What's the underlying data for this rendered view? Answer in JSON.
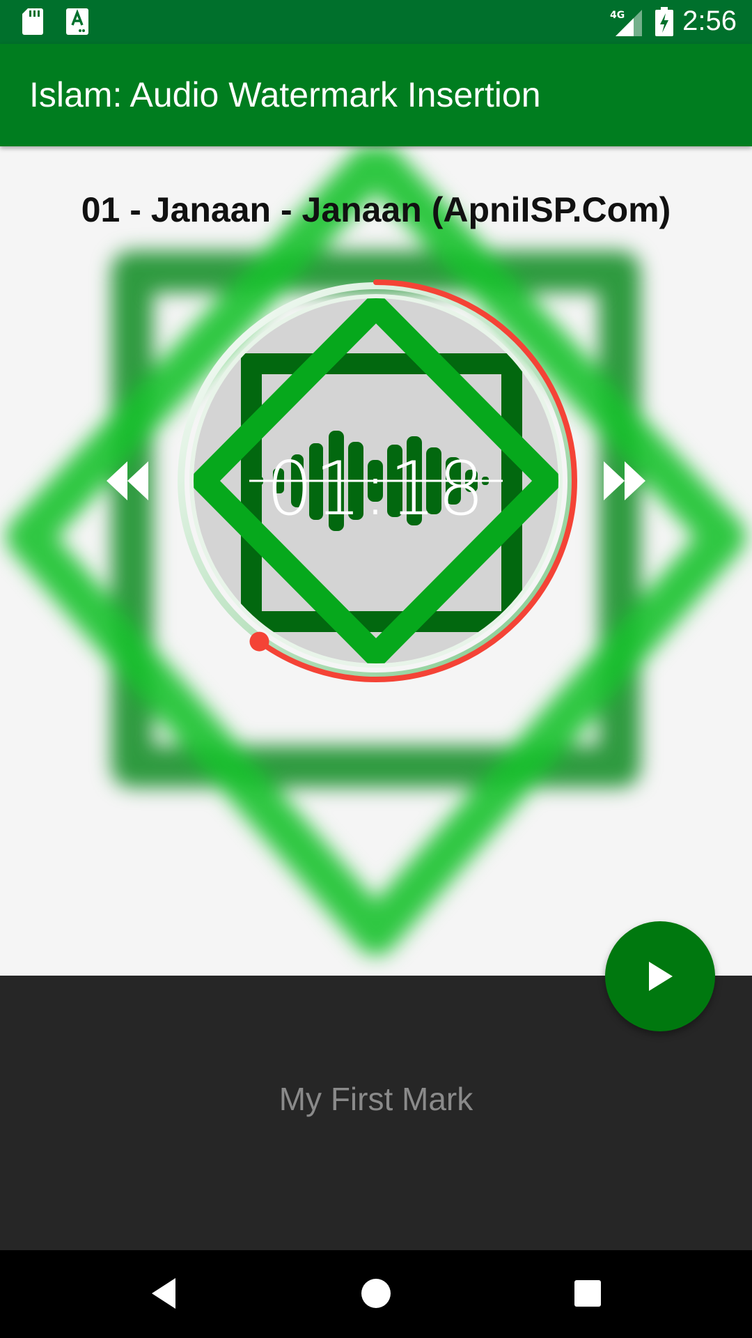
{
  "status_bar": {
    "network": "4G",
    "time": "2:56",
    "icons": [
      "sd-card-icon",
      "keyboard-a-icon",
      "signal-4g-icon",
      "battery-charging-icon"
    ]
  },
  "app_bar": {
    "title": "Islam: Audio Watermark Insertion"
  },
  "player": {
    "song_title": "01 - Janaan - Janaan (ApniISP.Com)",
    "elapsed": "01:18",
    "progress_fraction": 0.6,
    "rewind_icon": "fast-rewind-icon",
    "forward_icon": "fast-forward-icon",
    "play_icon": "play-icon"
  },
  "bottom_panel": {
    "mark_name": "My First Mark"
  },
  "nav_bar": {
    "icons": [
      "back-icon",
      "home-icon",
      "recents-icon"
    ]
  },
  "colors": {
    "status_bar": "#00702c",
    "app_bar": "#007d1f",
    "accent_red": "#f44336",
    "fab": "#00780f",
    "art_green": "#06a81c",
    "art_dark_green": "#02680f",
    "bottom_panel": "#262626"
  }
}
